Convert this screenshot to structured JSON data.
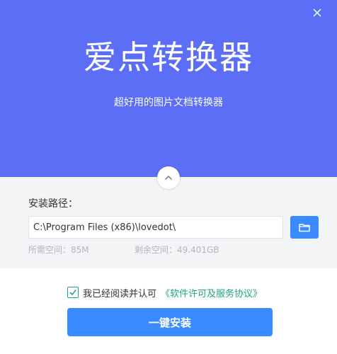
{
  "header": {
    "title": "爱点转换器",
    "subtitle": "超好用的图片文档转换器",
    "close_icon": "close-icon"
  },
  "install": {
    "path_label": "安装路径：",
    "path_value": "C:\\Program Files (x86)\\lovedot\\",
    "browse_icon": "folder-icon",
    "space_required": "所需空间：85M",
    "space_available": "剩余空间：49.401GB"
  },
  "agreement": {
    "checked": true,
    "text": "我已经阅读并认可",
    "link_text": "《软件许可及服务协议》"
  },
  "actions": {
    "install_label": "一键安装"
  },
  "colors": {
    "header_bg": "#5B6EF5",
    "panel_bg": "#F3F4F6",
    "primary": "#3A8BFF",
    "accent": "#1CA486",
    "muted": "#B2B6BE"
  }
}
